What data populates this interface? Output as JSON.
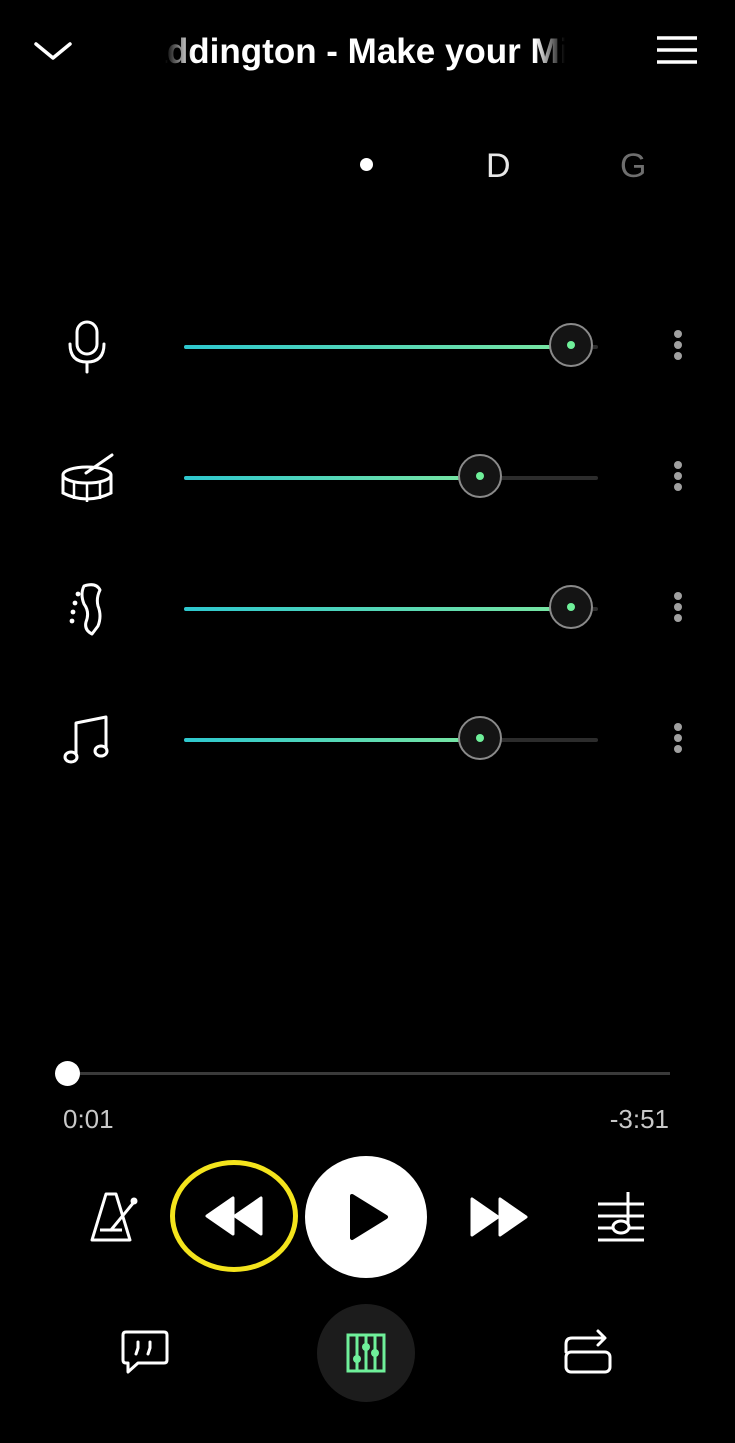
{
  "header": {
    "title": "Ed Sheeran & Jessie Ware & Kevin Paddington - Make your Mind Up",
    "collapse_icon": "chevron-down-icon",
    "menu_icon": "hamburger-menu-icon"
  },
  "chords": {
    "current": "D",
    "next": "G"
  },
  "tracks": [
    {
      "icon": "microphone-icon",
      "level": 0.94
    },
    {
      "icon": "drum-icon",
      "level": 0.72
    },
    {
      "icon": "guitar-headstock-icon",
      "level": 0.94
    },
    {
      "icon": "music-note-icon",
      "level": 0.72
    }
  ],
  "playback": {
    "elapsed": "0:01",
    "remaining": "-3:51",
    "progress": 0.005
  },
  "colors": {
    "accent": "#6ff09a",
    "slider_start": "#2ec8cf",
    "slider_end": "#7ae6a0",
    "highlight": "#f4e41c"
  }
}
